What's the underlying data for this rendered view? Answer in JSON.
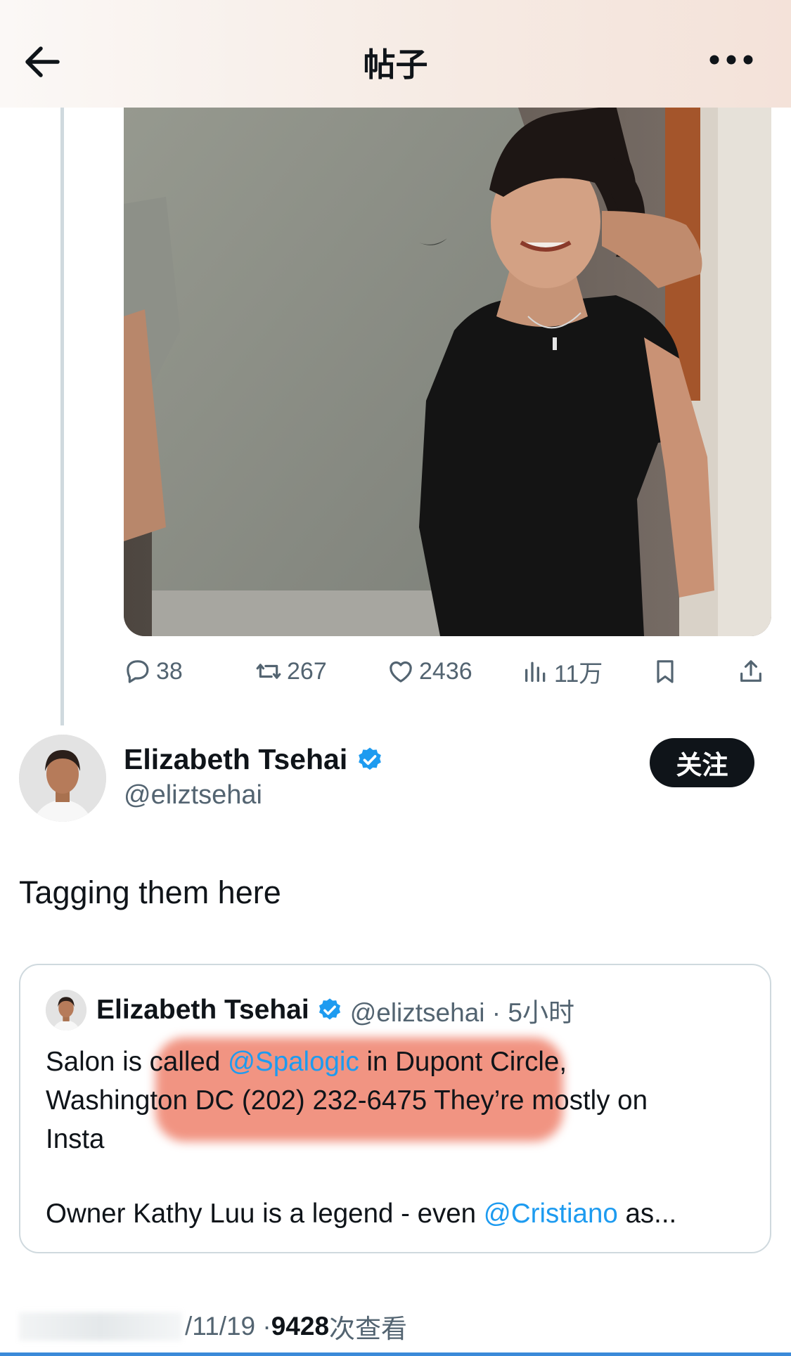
{
  "header": {
    "title": "帖子",
    "back_icon": "arrow-left-icon",
    "more_icon": "more-horizontal-icon"
  },
  "post_image": {
    "alt_subject": "photo-two-people"
  },
  "actions": {
    "replies": "38",
    "reposts": "267",
    "likes": "2436",
    "views": "11万",
    "icons": [
      "reply-icon",
      "repost-icon",
      "like-icon",
      "views-icon",
      "bookmark-icon",
      "share-icon"
    ]
  },
  "author": {
    "name": "Elizabeth Tsehai",
    "handle": "@eliztsehai",
    "follow_label": "关注",
    "verified_color": "#1d9bf0"
  },
  "tweet": {
    "text": "Tagging them here"
  },
  "quote": {
    "name": "Elizabeth Tsehai",
    "handle_time": "@eliztsehai · 5小时",
    "line1_a": "Salon is called ",
    "line1_mention": "@Spalogic",
    "line1_b": " in Dupont Circle,",
    "line2": "Washington DC (202) 232-6475 They’re mostly on",
    "line3": "Insta",
    "line4_a": "Owner Kathy Luu is a legend - even ",
    "line4_mention": "@Cristiano",
    "line4_b": " as..."
  },
  "footer": {
    "date_partial": "/11/19 · ",
    "view_count": "9428",
    "view_label": " 次查看"
  },
  "colors": {
    "accent": "#1d9bf0",
    "muted": "#536471",
    "text": "#0f1419",
    "highlight": "#e95235"
  }
}
